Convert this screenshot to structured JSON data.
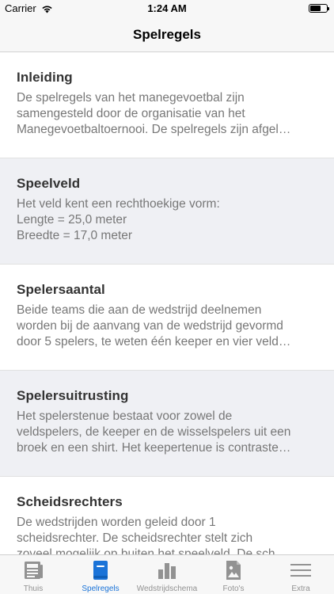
{
  "status_bar": {
    "carrier": "Carrier",
    "time": "1:24 AM"
  },
  "nav": {
    "title": "Spelregels"
  },
  "sections": [
    {
      "title": "Inleiding",
      "lines": [
        "De spelregels van het manegevoetbal zijn",
        "samengesteld door de organisatie van het",
        "Manegevoetbaltoernooi. De spelregels zijn afgel…"
      ]
    },
    {
      "title": "Speelveld",
      "lines": [
        "Het veld kent een rechthoekige vorm:",
        "Lengte = 25,0 meter",
        "Breedte = 17,0 meter"
      ]
    },
    {
      "title": "Spelersaantal",
      "lines": [
        "Beide teams die aan de wedstrijd deelnemen",
        "worden bij de aanvang van de wedstrijd gevormd",
        "door 5 spelers, te weten één keeper en vier veld…"
      ]
    },
    {
      "title": "Spelersuitrusting",
      "lines": [
        "Het spelerstenue bestaat voor zowel de",
        "veldspelers, de keeper en de wisselspelers uit een",
        "broek en een shirt. Het keepertenue is contraste…"
      ]
    },
    {
      "title": "Scheidsrechters",
      "lines": [
        "De wedstrijden worden geleid door 1",
        "scheidsrechter. De scheidsrechter stelt zich",
        "zoveel mogelijk op buiten het speelveld. De sch…"
      ]
    }
  ],
  "tabs": [
    {
      "label": "Thuis",
      "icon": "newspaper-icon",
      "active": false
    },
    {
      "label": "Spelregels",
      "icon": "book-icon",
      "active": true
    },
    {
      "label": "Wedstrijdschema",
      "icon": "bar-chart-icon",
      "active": false
    },
    {
      "label": "Foto's",
      "icon": "photo-icon",
      "active": false
    },
    {
      "label": "Extra",
      "icon": "menu-icon",
      "active": false
    }
  ],
  "colors": {
    "accent": "#1a73d8",
    "inactive": "#929292",
    "alt_row": "#eff0f4"
  }
}
